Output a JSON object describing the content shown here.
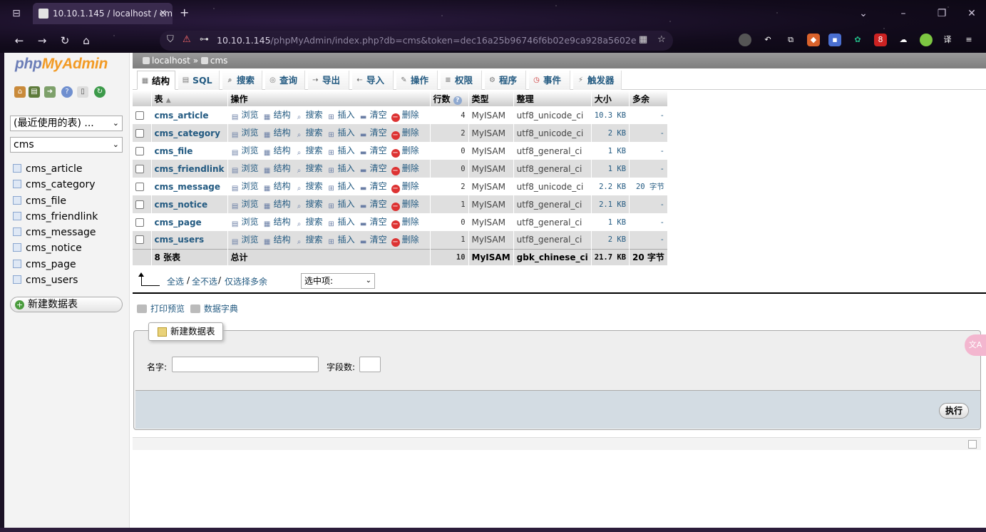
{
  "browser": {
    "tab_title": "10.10.1.145 / localhost / cms",
    "tab_close": "×",
    "new_tab": "+",
    "url_host": "10.10.1.145",
    "url_path": "/phpMyAdmin/index.php?db=cms&token=dec16a25b96746f6b02e9ca928a5602e",
    "ext_badge": "8"
  },
  "sidebar": {
    "logo_php": "php",
    "logo_myadmin": "MyAdmin",
    "recent_select": "(最近使用的表) ...",
    "db_select": "cms",
    "tables": [
      "cms_article",
      "cms_category",
      "cms_file",
      "cms_friendlink",
      "cms_message",
      "cms_notice",
      "cms_page",
      "cms_users"
    ],
    "new_table": "新建数据表"
  },
  "breadcrumb": {
    "server": "localhost",
    "sep": "»",
    "db": "cms"
  },
  "tabs": [
    "结构",
    "SQL",
    "搜索",
    "查询",
    "导出",
    "导入",
    "操作",
    "权限",
    "程序",
    "事件",
    "触发器"
  ],
  "table": {
    "headers": {
      "table": "表",
      "ops": "操作",
      "rows": "行数",
      "type": "类型",
      "collation": "整理",
      "size": "大小",
      "overhead": "多余"
    },
    "actions": {
      "browse": "浏览",
      "structure": "结构",
      "search": "搜索",
      "insert": "插入",
      "empty": "清空",
      "drop": "删除"
    },
    "rows": [
      {
        "name": "cms_article",
        "rows": "4",
        "type": "MyISAM",
        "collation": "utf8_unicode_ci",
        "size": "10.3 KB",
        "overhead": "-"
      },
      {
        "name": "cms_category",
        "rows": "2",
        "type": "MyISAM",
        "collation": "utf8_unicode_ci",
        "size": "2 KB",
        "overhead": "-"
      },
      {
        "name": "cms_file",
        "rows": "0",
        "type": "MyISAM",
        "collation": "utf8_general_ci",
        "size": "1 KB",
        "overhead": "-"
      },
      {
        "name": "cms_friendlink",
        "rows": "0",
        "type": "MyISAM",
        "collation": "utf8_general_ci",
        "size": "1 KB",
        "overhead": "-"
      },
      {
        "name": "cms_message",
        "rows": "2",
        "type": "MyISAM",
        "collation": "utf8_unicode_ci",
        "size": "2.2 KB",
        "overhead": "20 字节"
      },
      {
        "name": "cms_notice",
        "rows": "1",
        "type": "MyISAM",
        "collation": "utf8_general_ci",
        "size": "2.1 KB",
        "overhead": "-"
      },
      {
        "name": "cms_page",
        "rows": "0",
        "type": "MyISAM",
        "collation": "utf8_general_ci",
        "size": "1 KB",
        "overhead": "-"
      },
      {
        "name": "cms_users",
        "rows": "1",
        "type": "MyISAM",
        "collation": "utf8_general_ci",
        "size": "2 KB",
        "overhead": "-"
      }
    ],
    "total": {
      "label": "8 张表",
      "ops": "总计",
      "rows": "10",
      "type": "MyISAM",
      "collation": "gbk_chinese_ci",
      "size": "21.7 KB",
      "overhead": "20 字节"
    }
  },
  "footer": {
    "check_all": "全选",
    "sep": "/",
    "uncheck_all": "全不选",
    "check_overhead": "仅选择多余",
    "with_selected": "选中项:",
    "print_view": "打印预览",
    "data_dict": "数据字典"
  },
  "create": {
    "legend": "新建数据表",
    "name_label": "名字:",
    "fields_label": "字段数:",
    "go": "执行"
  },
  "translate_float": "文A"
}
